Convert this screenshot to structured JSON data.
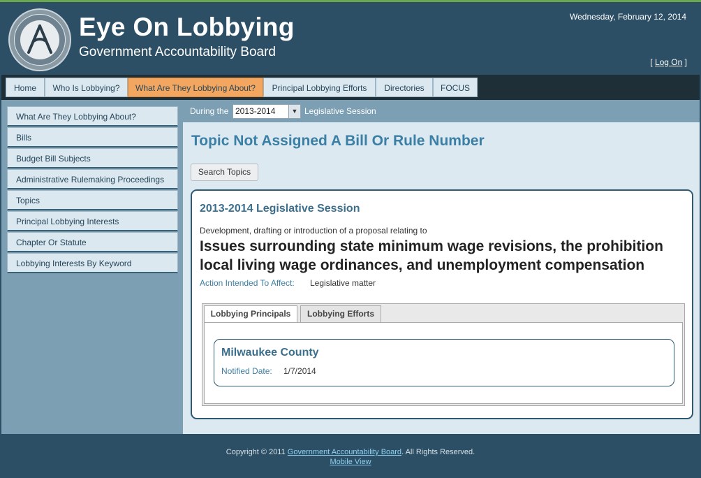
{
  "header": {
    "site_title": "Eye On Lobbying",
    "site_subtitle": "Government Accountability Board",
    "date": "Wednesday, February 12, 2014",
    "logon_prefix": "[",
    "logon_label": "Log On",
    "logon_suffix": "]",
    "seal_text": "GOVERNMENT ACCOUNTABILITY BOARD"
  },
  "nav": {
    "items": [
      {
        "label": "Home"
      },
      {
        "label": "Who Is Lobbying?"
      },
      {
        "label": "What Are They Lobbying About?",
        "active": true
      },
      {
        "label": "Principal Lobbying Efforts"
      },
      {
        "label": "Directories"
      },
      {
        "label": "FOCUS"
      }
    ]
  },
  "sidebar": {
    "items": [
      {
        "label": "What Are They Lobbying About?"
      },
      {
        "label": "Bills"
      },
      {
        "label": "Budget Bill Subjects"
      },
      {
        "label": "Administrative Rulemaking Proceedings"
      },
      {
        "label": "Topics"
      },
      {
        "label": "Principal Lobbying Interests"
      },
      {
        "label": "Chapter Or Statute"
      },
      {
        "label": "Lobbying Interests By Keyword"
      }
    ]
  },
  "session": {
    "prefix": "During the",
    "selected": "2013-2014",
    "suffix": "Legislative Session"
  },
  "main": {
    "page_title": "Topic Not Assigned A Bill Or Rule Number",
    "search_button": "Search Topics",
    "card": {
      "session_title": "2013-2014 Legislative Session",
      "intro": "Development, drafting or introduction of a proposal relating to",
      "topic": "Issues surrounding state minimum wage revisions, the prohibition local living wage ordinances, and unemployment compensation",
      "action_label": "Action Intended To Affect:",
      "action_value": "Legislative matter"
    },
    "tabs": [
      {
        "label": "Lobbying Principals",
        "active": true
      },
      {
        "label": "Lobbying Efforts"
      }
    ],
    "principal": {
      "name": "Milwaukee County",
      "notified_label": "Notified Date:",
      "notified_value": "1/7/2014"
    }
  },
  "footer": {
    "copyright_prefix": "Copyright © 2011",
    "copyright_link": "Government Accountability Board",
    "copyright_suffix": ". All Rights Reserved.",
    "mobile_view": "Mobile View"
  },
  "colors": {
    "header_bg": "#2c4f65",
    "nav_active": "#f3a65f",
    "accent_title": "#3b7fa4",
    "sidebar_bg": "#7c9fb3"
  }
}
